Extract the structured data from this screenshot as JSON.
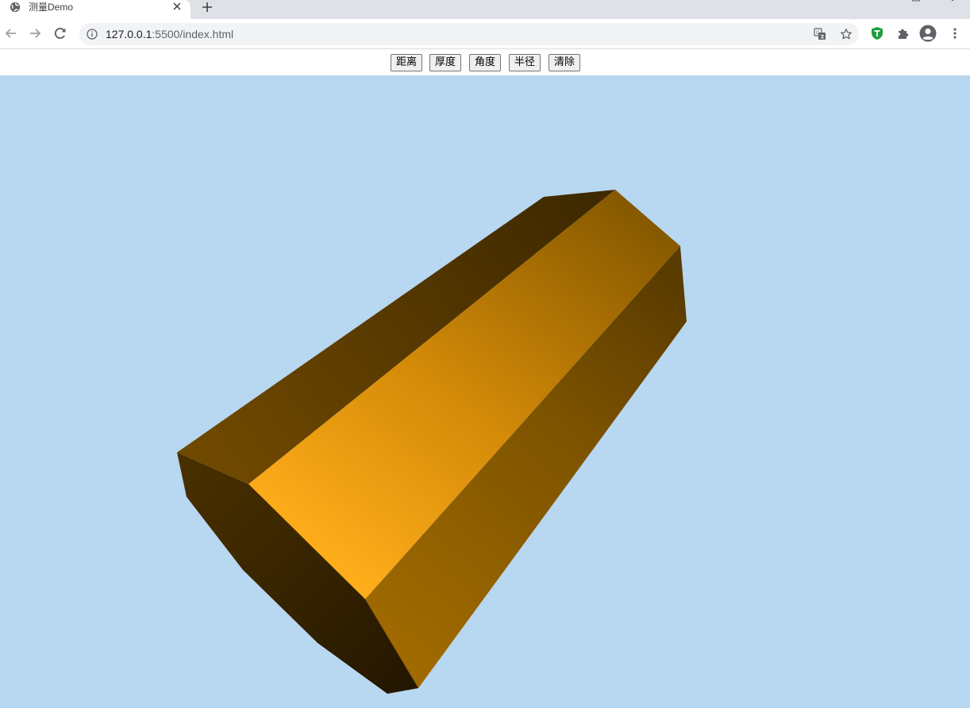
{
  "tab": {
    "title": "测量Demo",
    "favicon": "globe-icon",
    "close_icon": "close-icon"
  },
  "toolbar": {
    "back_icon": "arrow-left-icon",
    "forward_icon": "arrow-right-icon",
    "reload_icon": "reload-icon",
    "url_host": "127.0.0.1",
    "url_rest": ":5500/index.html",
    "translate_icon": "translate-icon",
    "bookmark_icon": "star-icon",
    "extensions": [
      "shield-extension-icon",
      "puzzle-icon",
      "profile-icon",
      "menu-dots-icon"
    ]
  },
  "controls": {
    "buttons": [
      {
        "label": "距离"
      },
      {
        "label": "厚度"
      },
      {
        "label": "角度"
      },
      {
        "label": "半径"
      },
      {
        "label": "清除"
      }
    ]
  },
  "scene": {
    "background": "#b8d7f0",
    "object": "octagonal-prism",
    "colors": {
      "top_light": "#ffad1a",
      "top_dark": "#7a5200",
      "left_face": "#4a3000",
      "right_face": "#8a5a00",
      "end_cap": "#2e1e00"
    }
  }
}
